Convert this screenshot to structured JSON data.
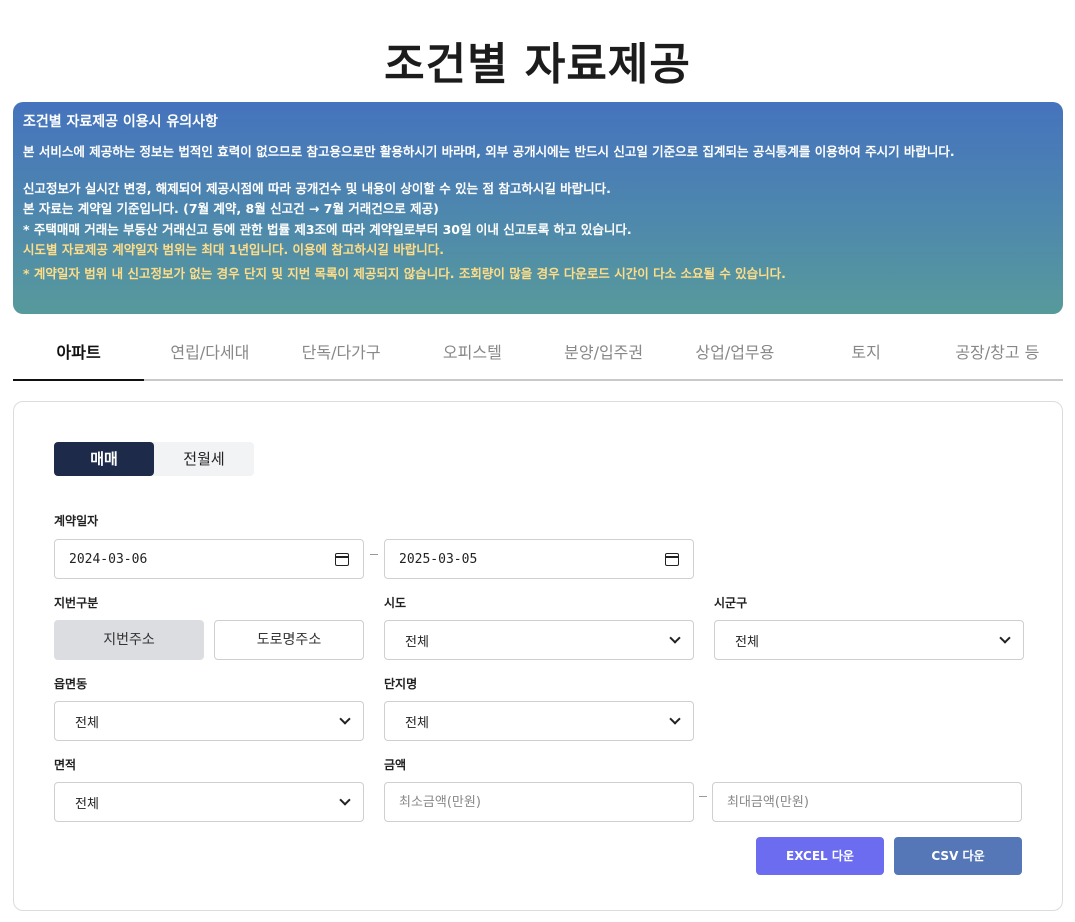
{
  "page": {
    "title": "조건별 자료제공"
  },
  "notice": {
    "title": "조건별 자료제공 이용시 유의사항",
    "lines": [
      "본 서비스에 제공하는 정보는 법적인 효력이 없으므로 참고용으로만 활용하시기 바라며, 외부 공개시에는 반드시 신고일 기준으로 집계되는 공식통계를 이용하여 주시기 바랍니다.",
      "신고정보가 실시간 변경, 해제되어 제공시점에 따라 공개건수 및 내용이 상이할 수 있는 점 참고하시길 바랍니다.",
      "본 자료는 계약일 기준입니다. (7월 계약, 8월 신고건 → 7월 거래건으로 제공)",
      "* 주택매매 거래는 부동산 거래신고 등에 관한 법률 제3조에 따라 계약일로부터 30일 이내 신고토록 하고 있습니다.",
      "시도별 자료제공 계약일자 범위는 최대 1년입니다. 이용에 참고하시길 바랍니다.",
      "* 계약일자 범위 내 신고정보가 없는 경우 단지 및 지번 목록이 제공되지 않습니다. 조회량이 많을 경우 다운로드 시간이 다소 소요될 수 있습니다."
    ],
    "warn_color": "#ffdd88"
  },
  "tabs": [
    {
      "label": "아파트",
      "active": true
    },
    {
      "label": "연립/다세대",
      "active": false
    },
    {
      "label": "단독/다가구",
      "active": false
    },
    {
      "label": "오피스텔",
      "active": false
    },
    {
      "label": "분양/입주권",
      "active": false
    },
    {
      "label": "상업/업무용",
      "active": false
    },
    {
      "label": "토지",
      "active": false
    },
    {
      "label": "공장/창고 등",
      "active": false
    }
  ],
  "form": {
    "deal_types": [
      "매매",
      "전월세"
    ],
    "contract_date": {
      "label": "계약일자",
      "start": "2024-03-06",
      "end": "2025-03-05"
    },
    "lot_type": {
      "label": "지번구분",
      "options": [
        "지번주소",
        "도로명주소"
      ]
    },
    "sido": {
      "label": "시도",
      "value": "전체"
    },
    "sigungu": {
      "label": "시군구",
      "value": "전체"
    },
    "eupmyeondong": {
      "label": "읍면동",
      "value": "전체"
    },
    "complex": {
      "label": "단지명",
      "value": "전체"
    },
    "area": {
      "label": "면적",
      "value": "전체"
    },
    "amount": {
      "label": "금액",
      "min_placeholder": "최소금액(만원)",
      "max_placeholder": "최대금액(만원)"
    },
    "buttons": {
      "excel": "EXCEL 다운",
      "csv": "CSV 다운"
    }
  },
  "colors": {
    "active_seg": "#1e2a4a",
    "excel": "#6b6cf0",
    "csv": "#5577b8"
  }
}
